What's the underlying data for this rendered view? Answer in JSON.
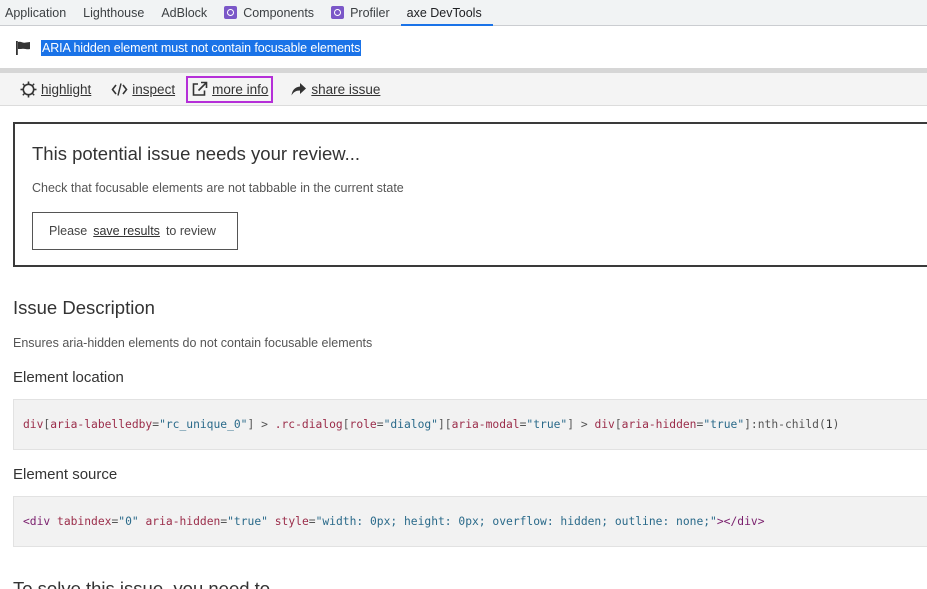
{
  "tabs": [
    {
      "label": "Application",
      "icon": null,
      "active": false
    },
    {
      "label": "Lighthouse",
      "icon": null,
      "active": false
    },
    {
      "label": "AdBlock",
      "icon": null,
      "active": false
    },
    {
      "label": "Components",
      "icon": "react-devtools-icon",
      "active": false
    },
    {
      "label": "Profiler",
      "icon": "react-devtools-icon",
      "active": false
    },
    {
      "label": "axe DevTools",
      "icon": null,
      "active": true
    }
  ],
  "issue": {
    "title": "ARIA hidden element must not contain focusable elements",
    "flag_icon": "flag-icon"
  },
  "actions": {
    "highlight": "highlight",
    "inspect": "inspect",
    "more_info": "more info",
    "share_issue": "share issue"
  },
  "review": {
    "title": "This potential issue needs your review...",
    "text": "Check that focusable elements are not tabbable in the current state",
    "prefix": "Please",
    "link": "save results",
    "suffix": "to review"
  },
  "description": {
    "heading": "Issue Description",
    "text": "Ensures aria-hidden elements do not contain focusable elements"
  },
  "element_location": {
    "heading": "Element location",
    "selector": "div[aria-labelledby=\"rc_unique_0\"] > .rc-dialog[role=\"dialog\"][aria-modal=\"true\"] > div[aria-hidden=\"true\"]:nth-child(1)"
  },
  "element_source": {
    "heading": "Element source",
    "source": "<div tabindex=\"0\" aria-hidden=\"true\" style=\"width: 0px; height: 0px; overflow: hidden; outline: none;\"></div>"
  },
  "solve": {
    "heading": "To solve this issue, you need to..."
  },
  "colors": {
    "accent": "#1a73e8",
    "focus_ring": "#b52fd8",
    "selector_color": "#9b2d4a",
    "string_color": "#2a6a8a",
    "tag_color": "#7a1f6d"
  }
}
